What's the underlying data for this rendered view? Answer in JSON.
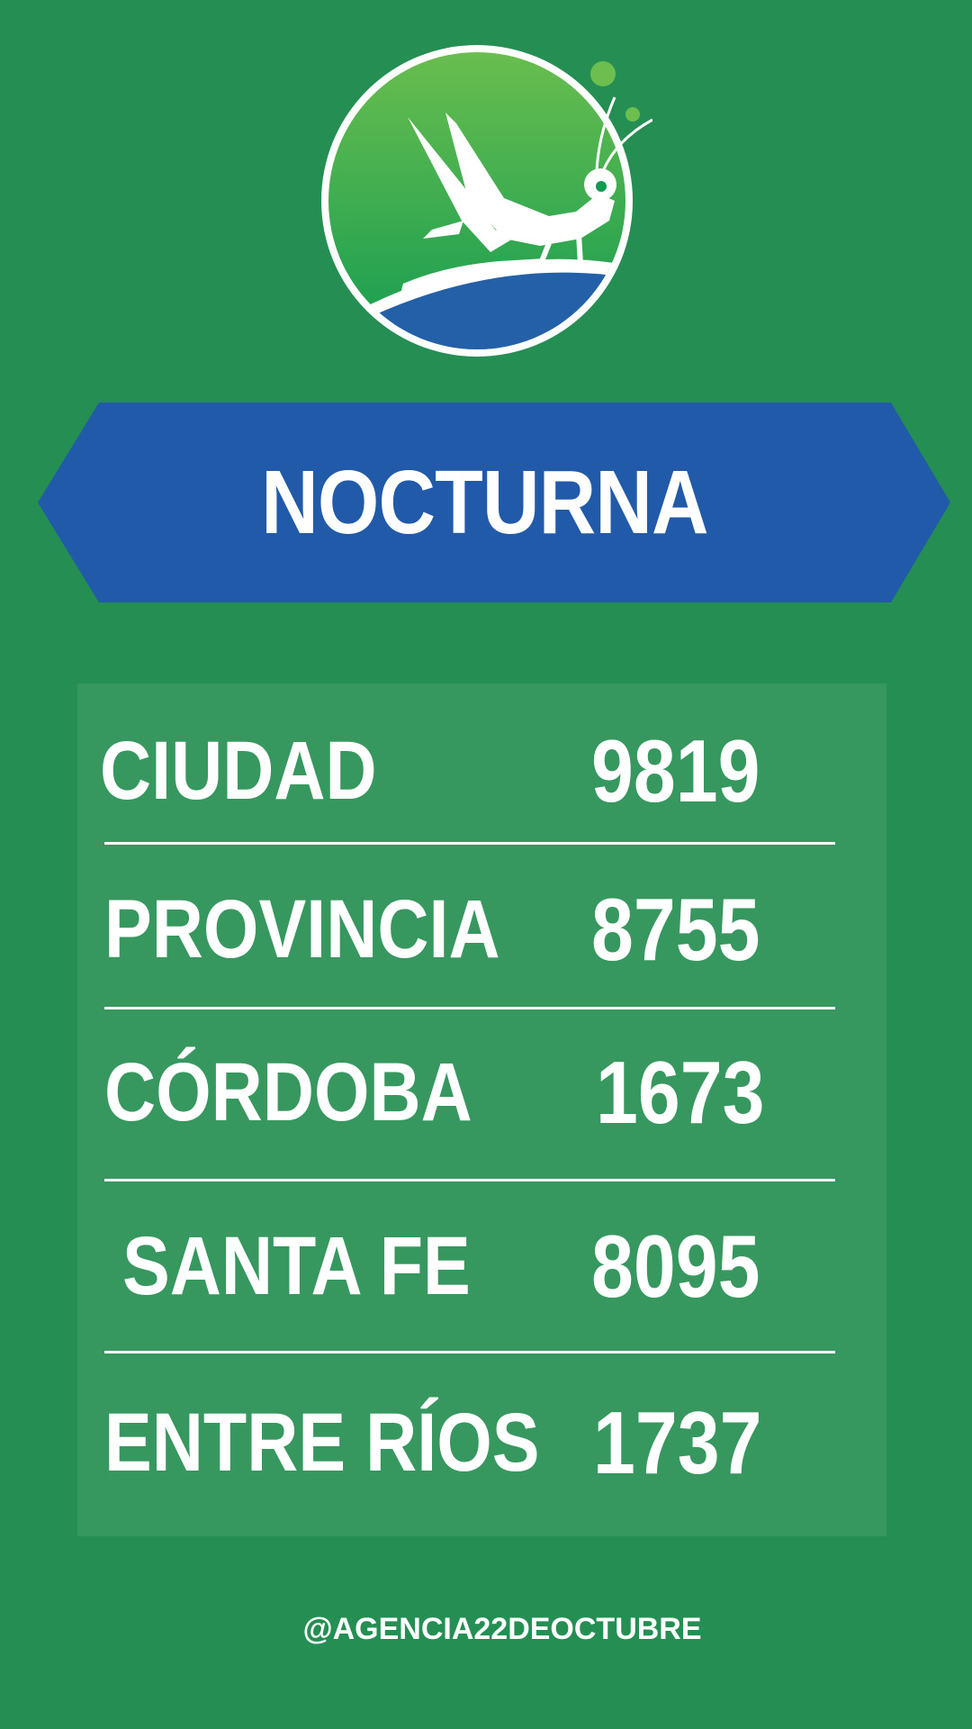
{
  "logo": {
    "icon": "grasshopper-logo"
  },
  "banner": {
    "title": "NOCTURNA"
  },
  "results": [
    {
      "name": "CIUDAD",
      "number": "9819"
    },
    {
      "name": "PROVINCIA",
      "number": "8755"
    },
    {
      "name": "CÓRDOBA",
      "number": "1673"
    },
    {
      "name": "SANTA FE",
      "number": "8095"
    },
    {
      "name": "ENTRE RÍOS",
      "number": "1737"
    }
  ],
  "footer": {
    "handle": "@AGENCIA22DEOCTUBRE"
  },
  "colors": {
    "background": "#258f53",
    "panel": "#36975f",
    "banner": "#215aa9",
    "text": "#ffffff"
  }
}
